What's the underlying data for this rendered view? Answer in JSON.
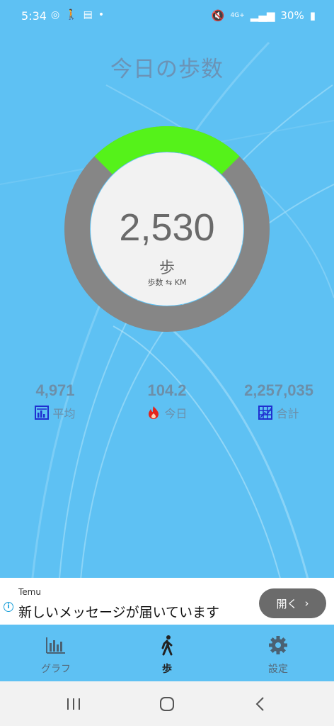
{
  "status_bar": {
    "time": "5:34",
    "network": "4G+",
    "battery": "30%",
    "dot": "•"
  },
  "page": {
    "title": "今日の歩数"
  },
  "steps": {
    "value": "2,530",
    "unit": "歩",
    "toggle": "歩数 ⇆ KM",
    "progress_fraction": 0.25
  },
  "stats": [
    {
      "value": "4,971",
      "label": "平均",
      "icon": "average-chart-icon"
    },
    {
      "value": "104.2",
      "label": "今日",
      "icon": "flame-icon"
    },
    {
      "value": "2,257,035",
      "label": "合計",
      "icon": "total-grid-icon"
    }
  ],
  "ad": {
    "source": "Temu",
    "text": "新しいメッセージが届いています",
    "button": "開く"
  },
  "bottom_nav": {
    "items": [
      {
        "label": "グラフ",
        "icon": "bar-chart-icon"
      },
      {
        "label": "歩",
        "icon": "walking-person-icon",
        "active": true
      },
      {
        "label": "設定",
        "icon": "gear-icon"
      }
    ]
  },
  "colors": {
    "background": "#5ec1f3",
    "progress": "#55f21a",
    "ring": "#868686",
    "center": "#f2f2f2"
  }
}
